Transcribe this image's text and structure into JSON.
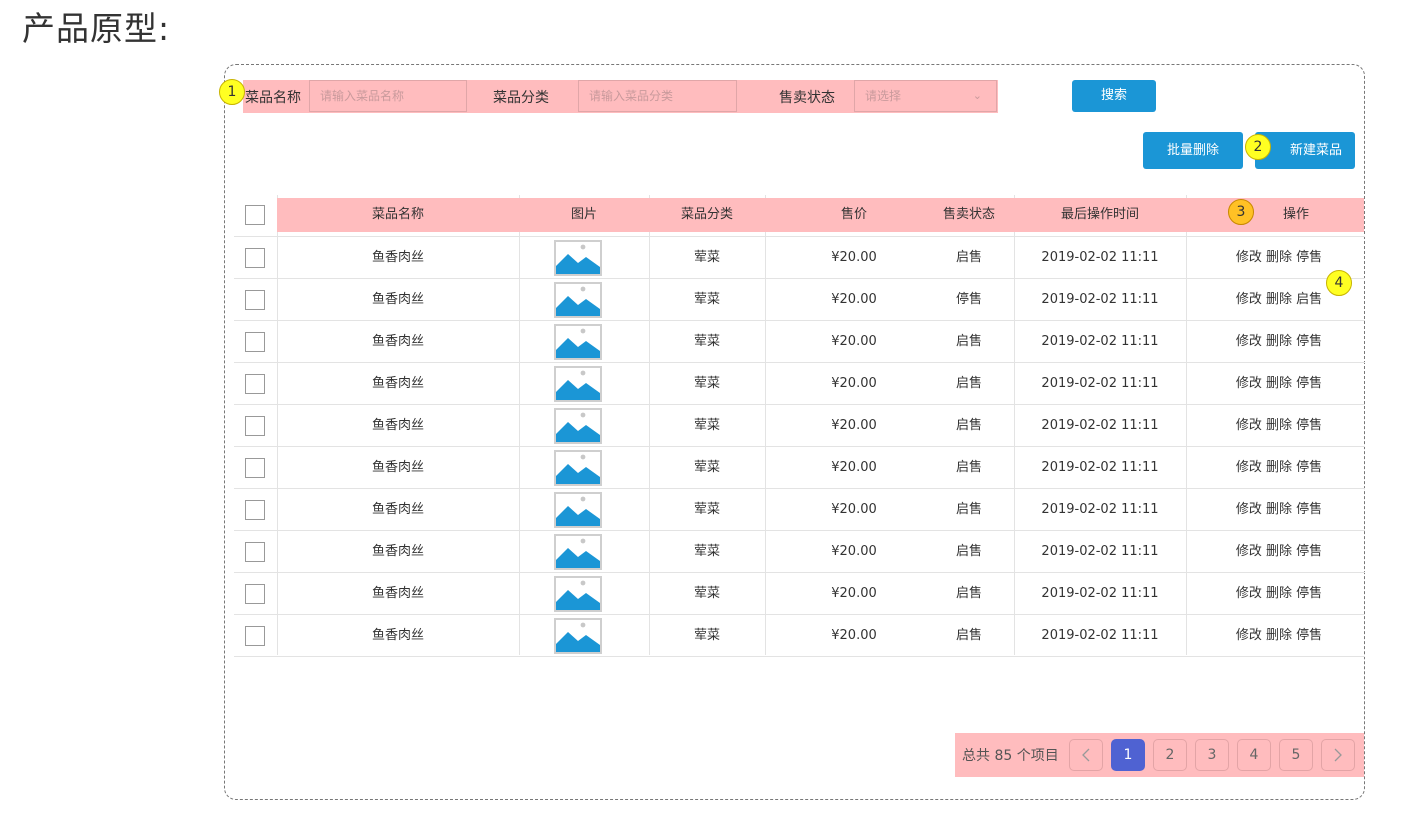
{
  "page_title": "产品原型:",
  "markers": {
    "m1": "1",
    "m2": "2",
    "m3": "3",
    "m4": "4"
  },
  "filters": {
    "name_label": "菜品名称",
    "name_placeholder": "请输入菜品名称",
    "category_label": "菜品分类",
    "category_placeholder": "请输入菜品分类",
    "status_label": "售卖状态",
    "status_placeholder": "请选择",
    "search_button": "搜索"
  },
  "toolbar": {
    "batch_delete": "批量删除",
    "new_dish": "新建菜品"
  },
  "table": {
    "headers": {
      "name": "菜品名称",
      "image": "图片",
      "category": "菜品分类",
      "price": "售价",
      "status": "售卖状态",
      "time": "最后操作时间",
      "actions": "操作"
    },
    "rows": [
      {
        "name": "鱼香肉丝",
        "category": "荤菜",
        "price": "¥20.00",
        "status": "启售",
        "time": "2019-02-02 11:11",
        "edit": "修改",
        "delete": "删除",
        "toggle": "停售"
      },
      {
        "name": "鱼香肉丝",
        "category": "荤菜",
        "price": "¥20.00",
        "status": "停售",
        "time": "2019-02-02 11:11",
        "edit": "修改",
        "delete": "删除",
        "toggle": "启售"
      },
      {
        "name": "鱼香肉丝",
        "category": "荤菜",
        "price": "¥20.00",
        "status": "启售",
        "time": "2019-02-02 11:11",
        "edit": "修改",
        "delete": "删除",
        "toggle": "停售"
      },
      {
        "name": "鱼香肉丝",
        "category": "荤菜",
        "price": "¥20.00",
        "status": "启售",
        "time": "2019-02-02 11:11",
        "edit": "修改",
        "delete": "删除",
        "toggle": "停售"
      },
      {
        "name": "鱼香肉丝",
        "category": "荤菜",
        "price": "¥20.00",
        "status": "启售",
        "time": "2019-02-02 11:11",
        "edit": "修改",
        "delete": "删除",
        "toggle": "停售"
      },
      {
        "name": "鱼香肉丝",
        "category": "荤菜",
        "price": "¥20.00",
        "status": "启售",
        "time": "2019-02-02 11:11",
        "edit": "修改",
        "delete": "删除",
        "toggle": "停售"
      },
      {
        "name": "鱼香肉丝",
        "category": "荤菜",
        "price": "¥20.00",
        "status": "启售",
        "time": "2019-02-02 11:11",
        "edit": "修改",
        "delete": "删除",
        "toggle": "停售"
      },
      {
        "name": "鱼香肉丝",
        "category": "荤菜",
        "price": "¥20.00",
        "status": "启售",
        "time": "2019-02-02 11:11",
        "edit": "修改",
        "delete": "删除",
        "toggle": "停售"
      },
      {
        "name": "鱼香肉丝",
        "category": "荤菜",
        "price": "¥20.00",
        "status": "启售",
        "time": "2019-02-02 11:11",
        "edit": "修改",
        "delete": "删除",
        "toggle": "停售"
      },
      {
        "name": "鱼香肉丝",
        "category": "荤菜",
        "price": "¥20.00",
        "status": "启售",
        "time": "2019-02-02 11:11",
        "edit": "修改",
        "delete": "删除",
        "toggle": "停售"
      }
    ]
  },
  "pagination": {
    "total_text": "总共 85 个项目",
    "pages": [
      "1",
      "2",
      "3",
      "4",
      "5"
    ],
    "current": "1",
    "prev_icon": "chevron-left-icon",
    "next_icon": "chevron-right-icon"
  },
  "colors": {
    "accent": "#1b96d6",
    "highlight": "#ffbcbe",
    "active_page": "#4f62d2",
    "marker_yellow": "#ffff22",
    "marker_orange": "#ffc125"
  }
}
